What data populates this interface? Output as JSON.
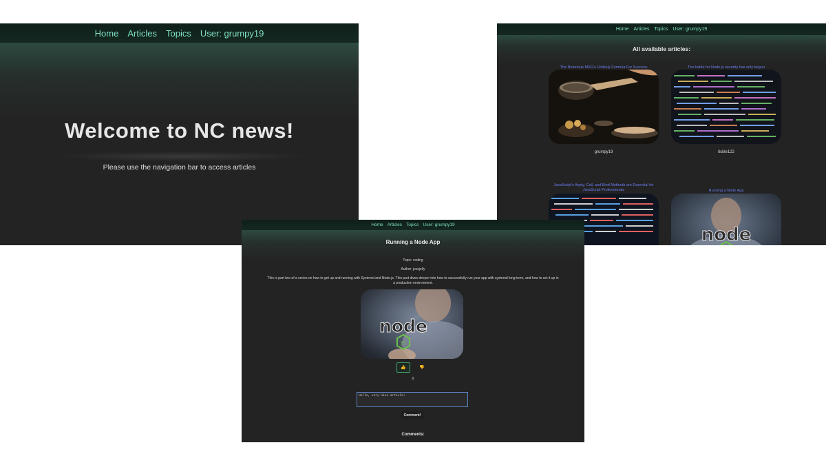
{
  "nav": {
    "home": "Home",
    "articles": "Articles",
    "topics": "Topics",
    "user": "User: grumpy19"
  },
  "home": {
    "title": "Welcome to NC news!",
    "subtitle": "Please use the navigation bar to access articles"
  },
  "articles": {
    "heading": "All available articles:",
    "cards": [
      {
        "title": "The Notorious MSG's Unlikely Formula For Success",
        "author": "grumpy19",
        "image": "food-photo"
      },
      {
        "title": "The battle for Node.js security has only begun",
        "author": "tickle122",
        "image": "code-screen-photo"
      },
      {
        "title": "JavaScript's Apply, Call, and Bind Methods are Essential for JavaScript Professionals",
        "author": "",
        "image": "code-screen-photo"
      },
      {
        "title": "Running a Node App",
        "author": "",
        "image": "node-logo-photo"
      }
    ]
  },
  "detail": {
    "title": "Running a Node App",
    "topic": "Topic: coding",
    "author": "Author: jessjelly",
    "body": "This is part two of a series on how to get up and running with Systemd and Node.js. This part dives deeper into how to successfully run your app with systemd long-term, and how to set it up in a production environment.",
    "upvote_icon": "thumbs-up-icon",
    "downvote_icon": "thumbs-down-icon",
    "votes": "0",
    "comment_value": "Hello, very nice article!",
    "comment_button": "Comment!",
    "comments_heading": "Comments:"
  },
  "colors": {
    "accent": "#7fe0c4",
    "link_blue": "#6b7cf0",
    "background": "#232323"
  }
}
